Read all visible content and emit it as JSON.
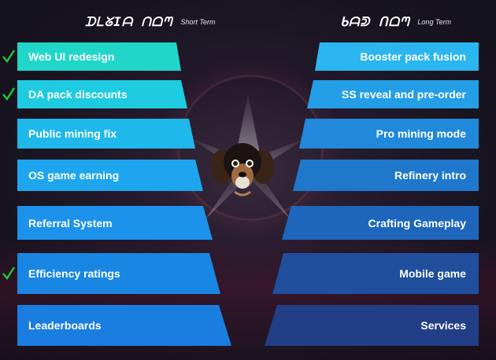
{
  "headers": {
    "short": {
      "glyphs": "ᗪᒪᘜIᗩ ᑎᗝᘉ",
      "label": "Short Term"
    },
    "long": {
      "glyphs": "ᑲᗩᕲ ᑎᗝᘉ",
      "label": "Long Term"
    }
  },
  "short_term": [
    {
      "label": "Web UI redesign",
      "done": true
    },
    {
      "label": "DA pack discounts",
      "done": true
    },
    {
      "label": "Public mining fix",
      "done": false
    },
    {
      "label": "OS game earning",
      "done": false
    },
    {
      "label": "Referral System",
      "done": false
    },
    {
      "label": "Efficiency ratings",
      "done": true
    },
    {
      "label": "Leaderboards",
      "done": false
    }
  ],
  "long_term": [
    {
      "label": "Booster pack fusion"
    },
    {
      "label": "SS reveal and pre-order"
    },
    {
      "label": "Pro mining mode"
    },
    {
      "label": "Refinery intro"
    },
    {
      "label": "Crafting Gameplay"
    },
    {
      "label": "Mobile game"
    },
    {
      "label": "Services"
    }
  ],
  "colors": {
    "check": "#22c33a",
    "short_gradient": [
      "#1fd6c9",
      "#1ecbe0",
      "#1fb8ea",
      "#1da6ee",
      "#1c92ea",
      "#1a86e4",
      "#1a7ee0"
    ],
    "long_gradient": [
      "#2bb6f0",
      "#249ee6",
      "#2189da",
      "#1f78cc",
      "#1e66bb",
      "#1f4f9d",
      "#223e86"
    ]
  }
}
